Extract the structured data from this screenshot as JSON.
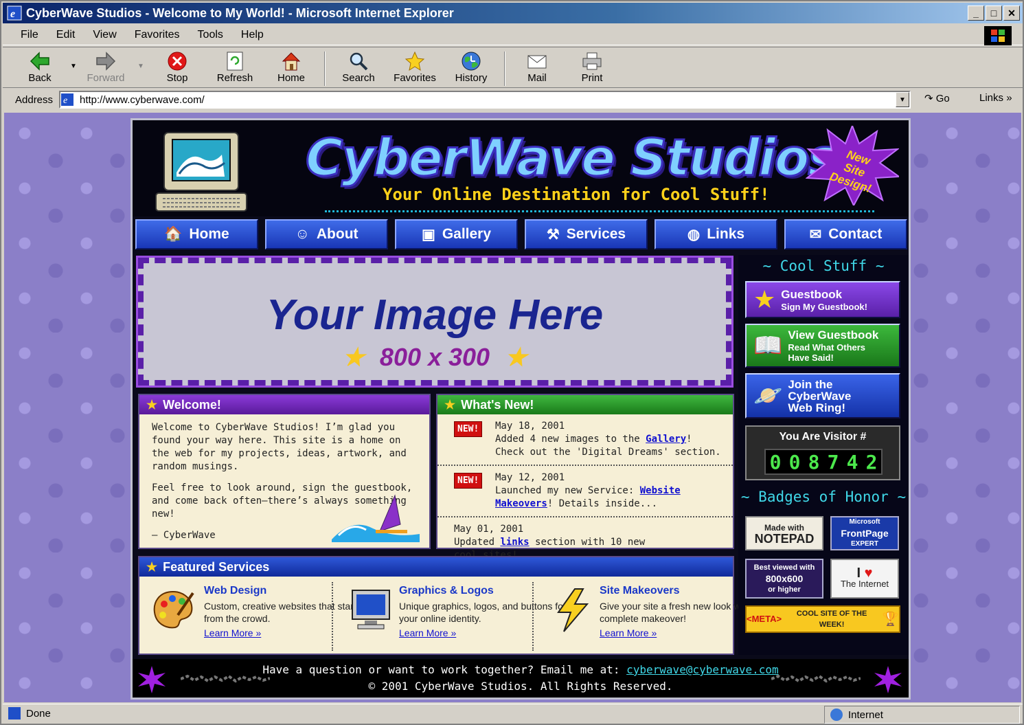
{
  "window": {
    "title": "CyberWave Studios - Welcome to My World! - Microsoft Internet Explorer",
    "controls": [
      "_",
      "□",
      "✕"
    ]
  },
  "menu": [
    "File",
    "Edit",
    "View",
    "Favorites",
    "Tools",
    "Help"
  ],
  "toolbar": {
    "back": "Back",
    "forward": "Forward",
    "stop": "Stop",
    "refresh": "Refresh",
    "home": "Home",
    "search": "Search",
    "favorites": "Favorites",
    "history": "History",
    "mail": "Mail",
    "print": "Print"
  },
  "address": {
    "label": "Address",
    "url": "http://www.cyberwave.com/",
    "go": "Go",
    "links": "Links"
  },
  "status": {
    "text": "Done",
    "zone": "Internet"
  },
  "header": {
    "title": "CyberWave Studios",
    "tagline": "Your Online Destination for Cool Stuff!",
    "burst": [
      "New",
      "Site",
      "Design!"
    ]
  },
  "nav": [
    "Home",
    "About",
    "Gallery",
    "Services",
    "Links",
    "Contact"
  ],
  "hero": {
    "title": "Your Image Here",
    "size": "800 x 300"
  },
  "welcome": {
    "heading": "Welcome!",
    "p1": "Welcome to CyberWave Studios! I’m glad you found your way here. This site is a home on the web for my projects, ideas, artwork, and random musings.",
    "p2": "Feel free to look around, sign the guestbook, and come back often—there’s always something new!",
    "sign": "– CyberWave"
  },
  "news": {
    "heading": "What's New!",
    "badge": "NEW!",
    "i1_date": "May 18, 2001",
    "i1_a": "Added 4 new images to the ",
    "i1_link": "Gallery",
    "i1_b": "!",
    "i1_c": "Check out the 'Digital Dreams' section.",
    "i2_date": "May 12, 2001",
    "i2_a": "Launched my new Service: ",
    "i2_link1": "Website",
    "i2_link2": "Makeovers",
    "i2_b": "! Details inside...",
    "i3_date": "May 01, 2001",
    "i3_a": "Updated ",
    "i3_link": "links",
    "i3_b": " section with 10 new",
    "i3_c": "cool sites!"
  },
  "services": {
    "heading": "Featured Services",
    "more": "Learn More »",
    "s1_title": "Web Design",
    "s1_desc": "Custom, creative websites that stand out from the crowd.",
    "s2_title": "Graphics & Logos",
    "s2_desc": "Unique graphics, logos, and buttons for your online identity.",
    "s3_title": "Site Makeovers",
    "s3_desc": "Give your site a fresh new look with a complete makeover!"
  },
  "sidebar": {
    "cool_heading": "~ Cool Stuff ~",
    "gb_title": "Guestbook",
    "gb_sub": "Sign My Guestbook!",
    "vg_title": "View Guestbook",
    "vg_sub1": "Read What Others",
    "vg_sub2": "Have Said!",
    "ring1": "Join the",
    "ring2": "CyberWave",
    "ring3": "Web Ring!",
    "visitor_label": "You Are Visitor #",
    "visitor_digits": [
      "0",
      "0",
      "8",
      "7",
      "4",
      "2"
    ],
    "badges_heading": "~ Badges of Honor ~",
    "b1a": "Made with",
    "b1b": "NOTEPAD",
    "b2a": "Microsoft",
    "b2b": "FrontPage",
    "b2c": "EXPERT",
    "b3a": "Best viewed with",
    "b3b": "800x600",
    "b3c": "or higher",
    "b4a": "I",
    "b4b": "The Internet",
    "b5a": "<META>",
    "b5b": "COOL SITE OF THE WEEK!"
  },
  "footer": {
    "line1": "Have a question or want to work together?  Email me at: ",
    "email": "cyberwave@cyberwave.com",
    "line2": "© 2001 CyberWave Studios. All Rights Reserved."
  }
}
